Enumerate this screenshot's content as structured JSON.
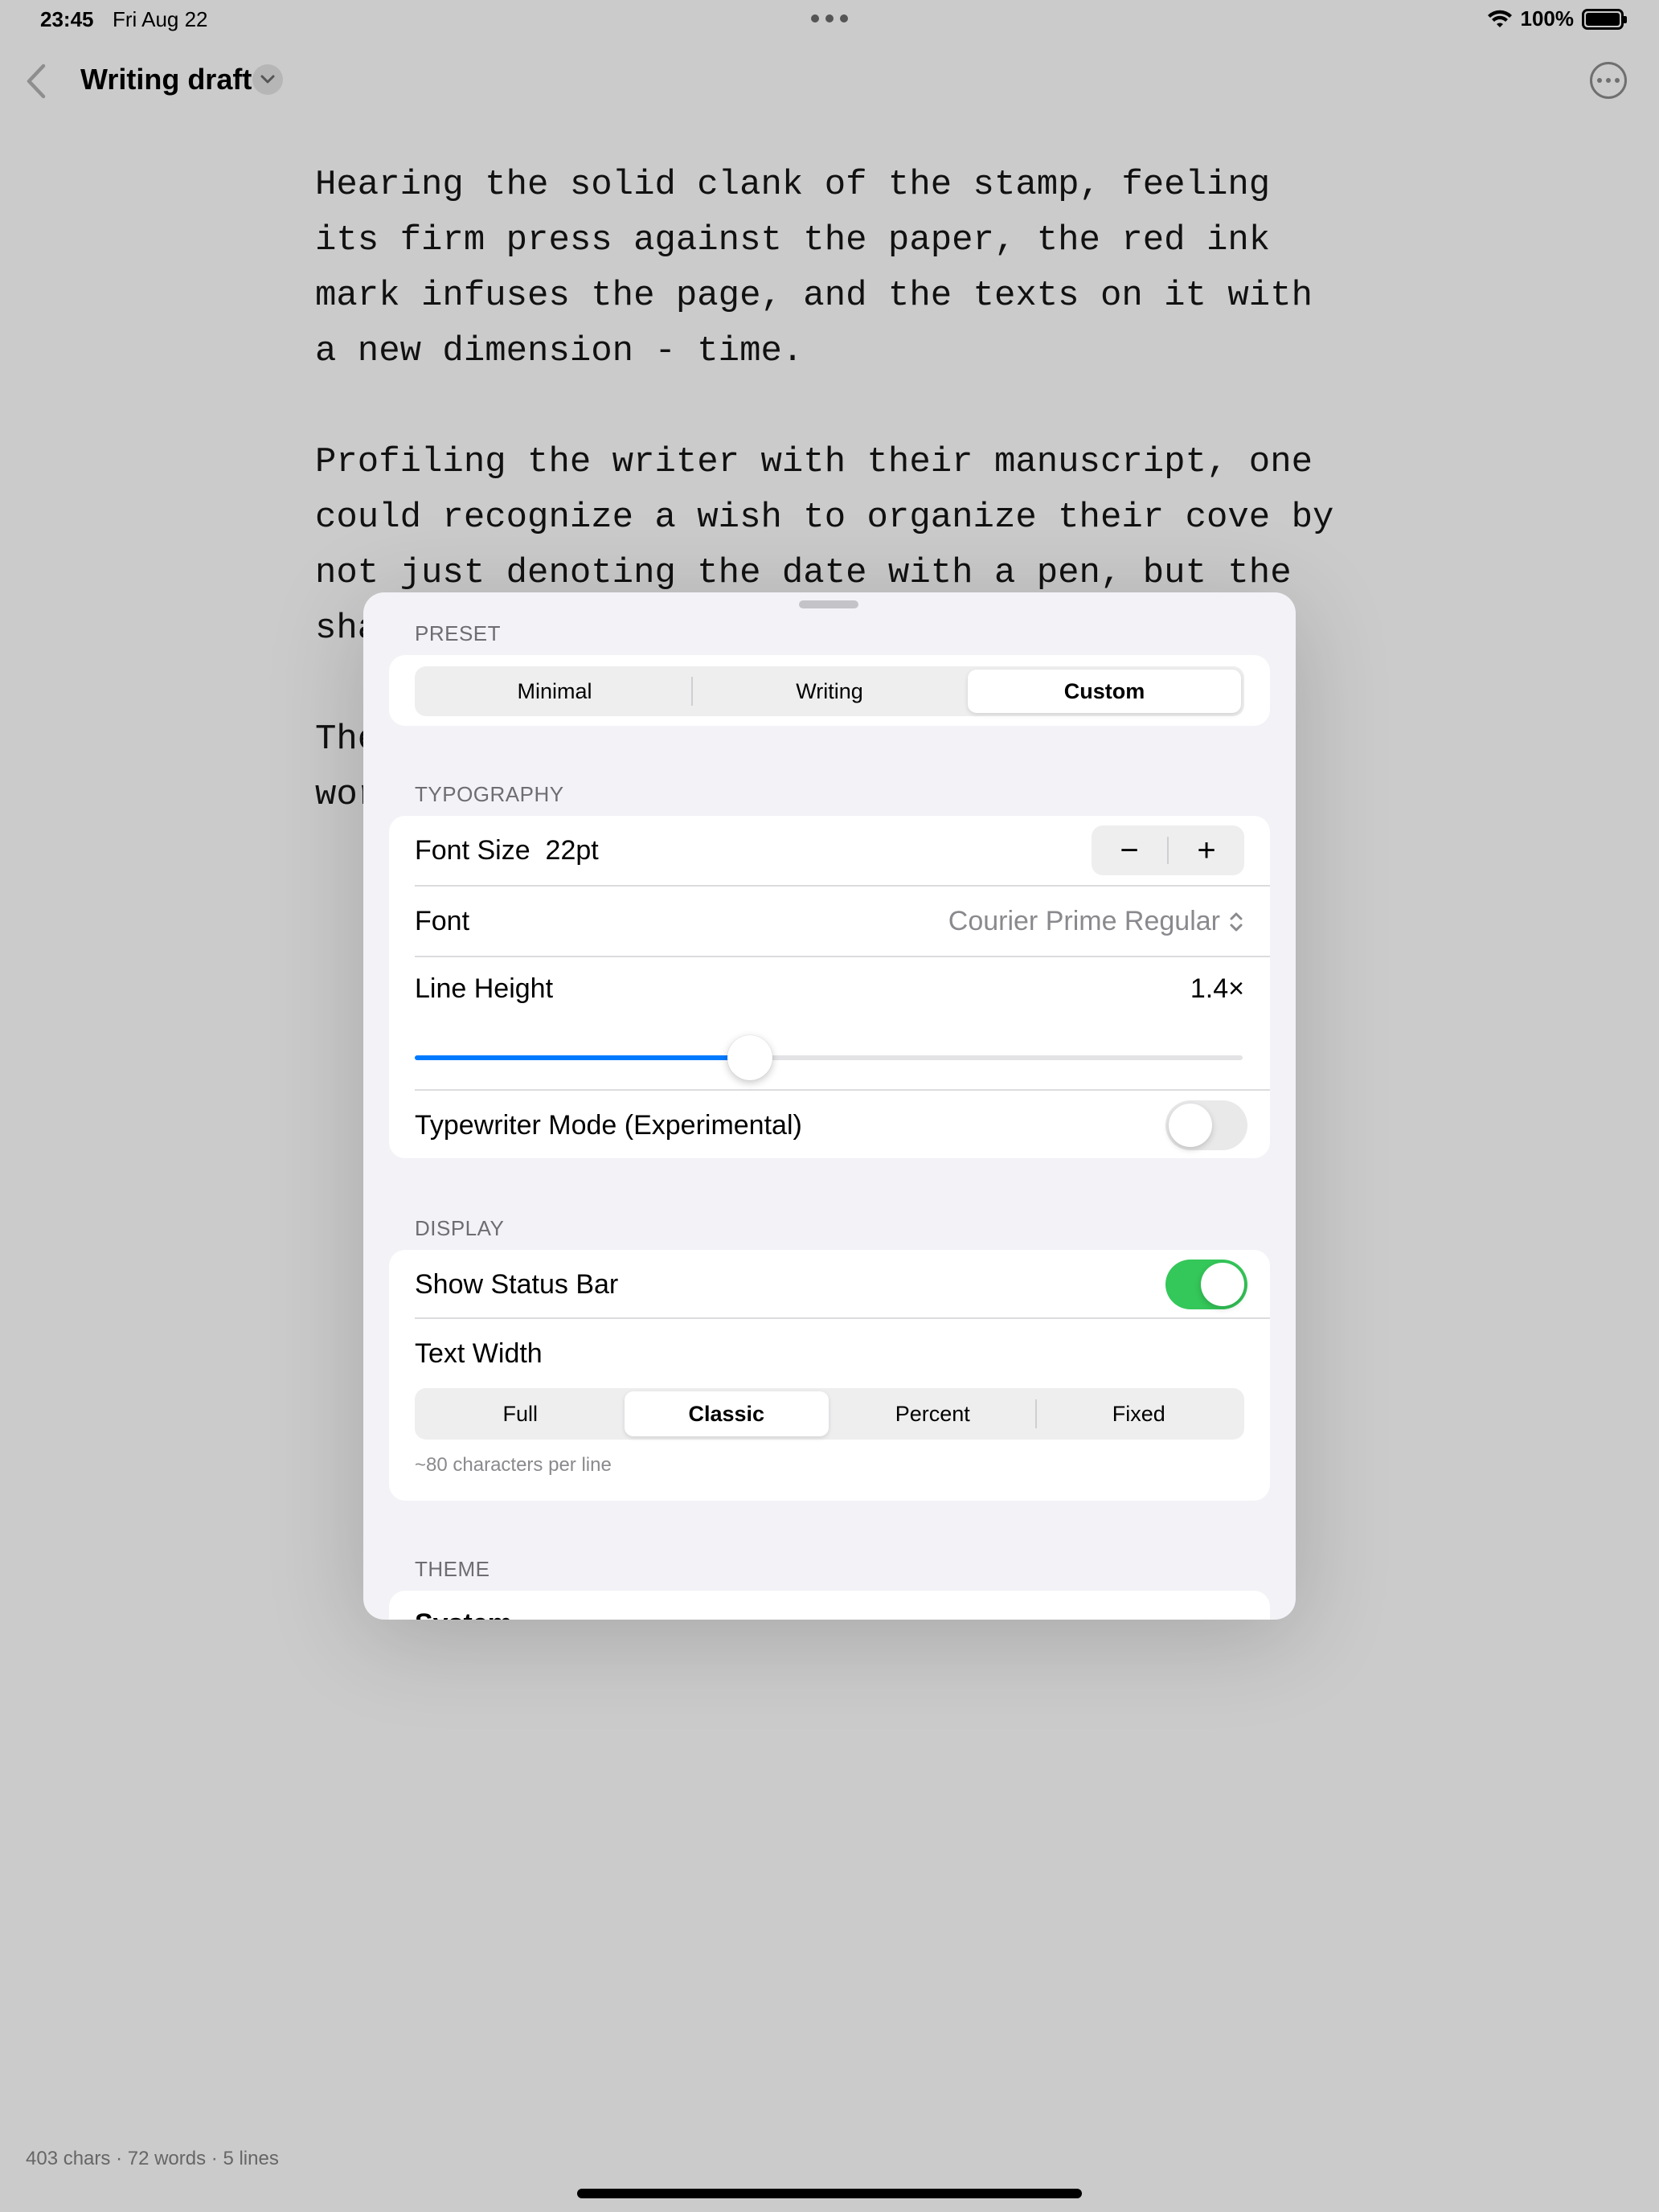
{
  "status_bar": {
    "time": "23:45",
    "date": "Fri Aug 22",
    "battery": "100%"
  },
  "nav": {
    "title": "Writing draft"
  },
  "editor": {
    "paragraphs": [
      "Hearing the solid clank of the stamp, feeling\nits firm press against the paper, the red ink\nmark infuses the page, and the texts on it with\na new dimension - time.",
      "Profiling the writer with their manuscript, one\ncould recognize a wish to organize their cove by\nnot just denoting the date with a pen, but the\nsha",
      "The\nwor"
    ]
  },
  "counts": "403 chars · 72 words · 5 lines",
  "settings": {
    "preset": {
      "header": "PRESET",
      "options": [
        "Minimal",
        "Writing",
        "Custom"
      ],
      "selected": "Custom"
    },
    "typography": {
      "header": "TYPOGRAPHY",
      "font_size_label": "Font Size",
      "font_size_value": "22pt",
      "minus": "−",
      "plus": "+",
      "font_label": "Font",
      "font_value": "Courier Prime Regular",
      "line_height_label": "Line Height",
      "line_height_value": "1.4×",
      "line_height_fraction": 0.405,
      "typewriter_label": "Typewriter Mode (Experimental)",
      "typewriter_on": false
    },
    "display": {
      "header": "DISPLAY",
      "status_bar_label": "Show Status Bar",
      "status_bar_on": true,
      "text_width_label": "Text Width",
      "text_width_options": [
        "Full",
        "Classic",
        "Percent",
        "Fixed"
      ],
      "text_width_selected": "Classic",
      "text_width_note": "~80 characters per line"
    },
    "theme": {
      "header": "THEME",
      "partial_label": "System"
    }
  },
  "colors": {
    "accent": "#007aff",
    "toggle_on": "#34c759"
  }
}
